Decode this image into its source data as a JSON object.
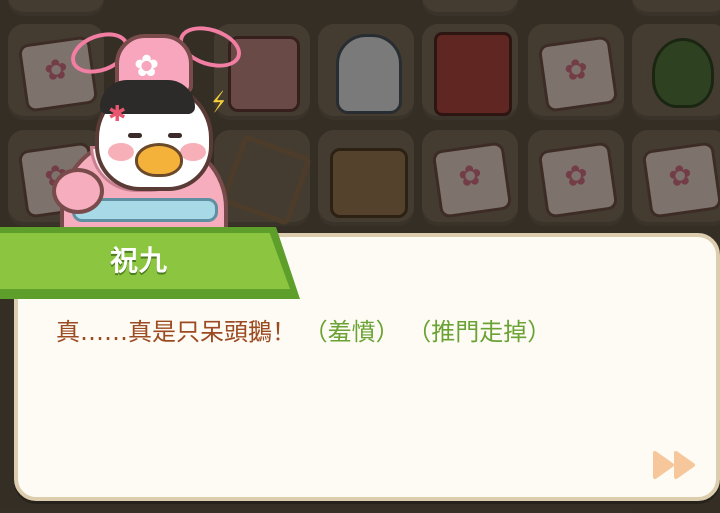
{
  "dialog": {
    "speaker": "祝九",
    "line": "真……真是只呆頭鵝！",
    "action_1": "（羞憤）",
    "action_2": "（推門走掉）"
  },
  "icons": {
    "skip": "fast-forward-icon"
  },
  "colors": {
    "name_tab": "#8cc53f",
    "dialog_text": "#9c4a22",
    "action_text": "#6aa234",
    "dialog_bg": "#fdfbf3",
    "skip_icon": "#f6c79a"
  }
}
